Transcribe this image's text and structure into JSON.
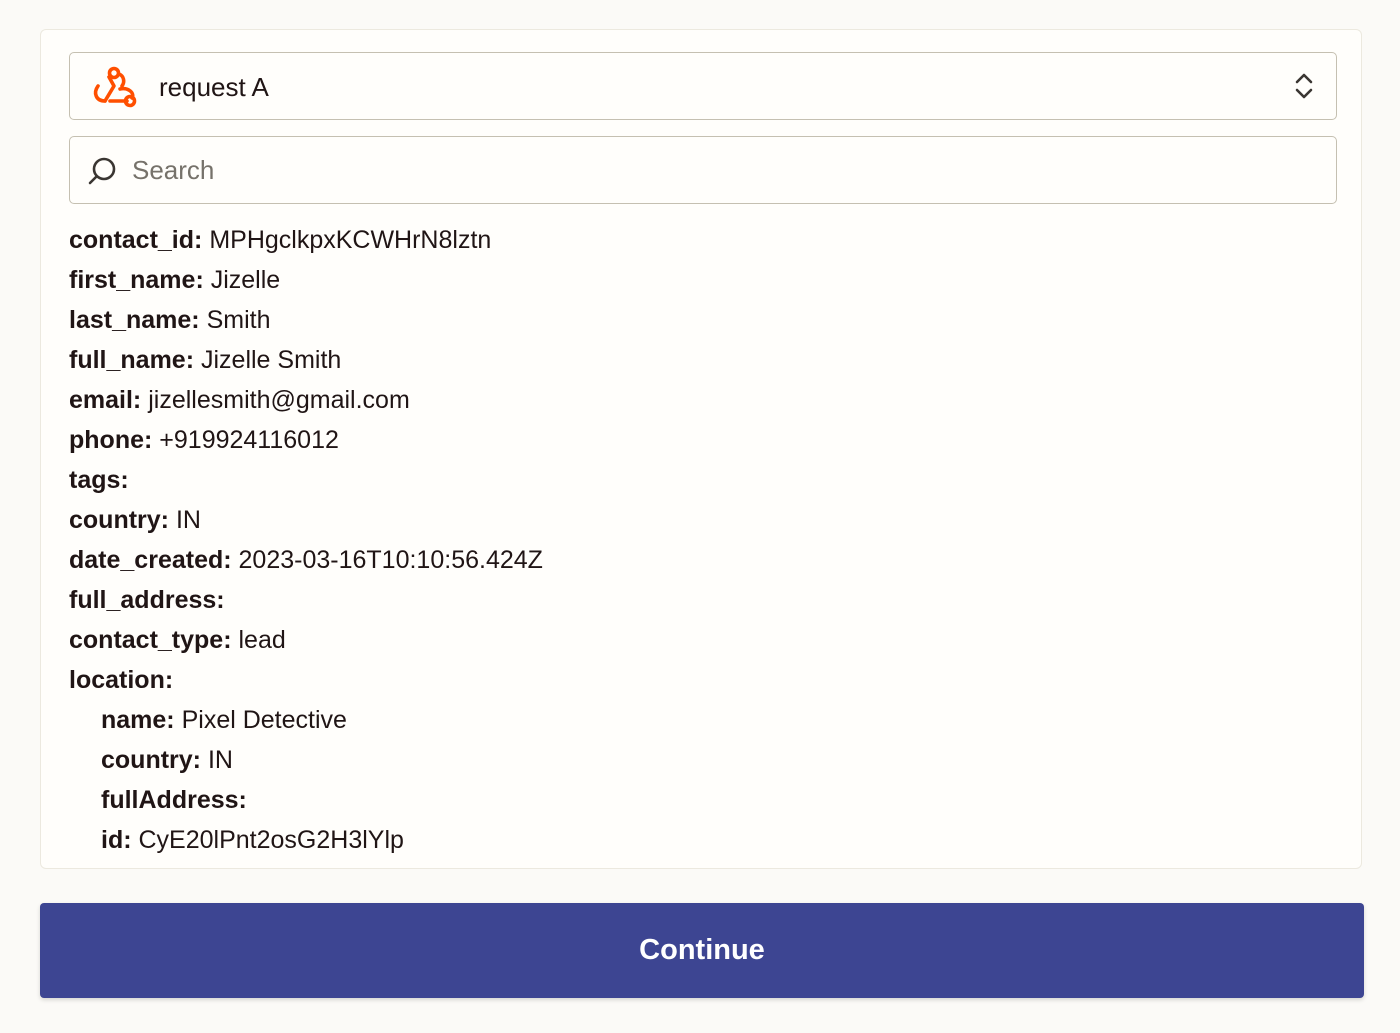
{
  "selector": {
    "label": "request A",
    "icon": "webhook-icon",
    "accent_color": "#ff4f00"
  },
  "search": {
    "placeholder": "Search",
    "value": ""
  },
  "fields": [
    {
      "key": "contact_id:",
      "value": "MPHgclkpxKCWHrN8lztn"
    },
    {
      "key": "first_name:",
      "value": "Jizelle"
    },
    {
      "key": "last_name:",
      "value": "Smith"
    },
    {
      "key": "full_name:",
      "value": "Jizelle Smith"
    },
    {
      "key": "email:",
      "value": "jizellesmith@gmail.com"
    },
    {
      "key": "phone:",
      "value": "+919924116012"
    },
    {
      "key": "tags:",
      "value": ""
    },
    {
      "key": "country:",
      "value": "IN"
    },
    {
      "key": "date_created:",
      "value": "2023-03-16T10:10:56.424Z"
    },
    {
      "key": "full_address:",
      "value": ""
    },
    {
      "key": "contact_type:",
      "value": "lead"
    },
    {
      "key": "location:",
      "value": ""
    }
  ],
  "location_fields": [
    {
      "key": "name:",
      "value": "Pixel Detective"
    },
    {
      "key": "country:",
      "value": "IN"
    },
    {
      "key": "fullAddress:",
      "value": ""
    },
    {
      "key": "id:",
      "value": "CyE20lPnt2osG2H3lYlp"
    }
  ],
  "button": {
    "label": "Continue",
    "color": "#3d4592"
  }
}
